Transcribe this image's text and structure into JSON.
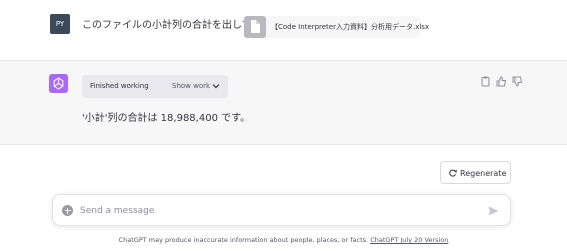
{
  "user_message": {
    "avatar_initials": "PY",
    "text": "このファイルの小計列の合計を出してください",
    "attachment": {
      "file_name": "【Code Interpreter入力資料】分析用データ.xlsx",
      "icon": "file-icon"
    }
  },
  "assistant_message": {
    "status_label": "Finished working",
    "show_work_label": "Show work",
    "answer": "'小計'列の合計は 18,988,400 です。",
    "actions": [
      "copy-icon",
      "thumbs-up-icon",
      "thumbs-down-icon"
    ]
  },
  "regenerate": {
    "label": "Regenerate"
  },
  "composer": {
    "placeholder": "Send a message"
  },
  "footer": {
    "text": "ChatGPT may produce inaccurate information about people, places, or facts. ",
    "version_link": "ChatGPT July 20 Version"
  },
  "colors": {
    "bot_avatar": "#ab68ff",
    "user_avatar": "#3b4a5a"
  }
}
